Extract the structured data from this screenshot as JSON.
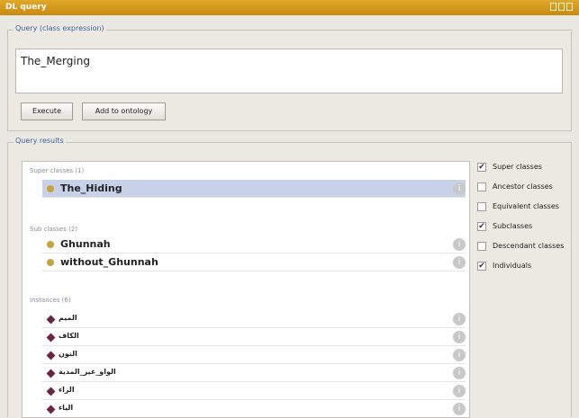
{
  "window": {
    "title": "DL query"
  },
  "query": {
    "title": "Query (class expression)",
    "expression": "The_Merging",
    "execute_label": "Execute",
    "add_label": "Add to ontology"
  },
  "results": {
    "title": "Query results",
    "super_title": "Super classes (1)",
    "super_items": [
      {
        "label": "The_Hiding"
      }
    ],
    "sub_title": "Sub classes (2)",
    "sub_items": [
      {
        "label": "Ghunnah"
      },
      {
        "label": "without_Ghunnah"
      }
    ],
    "inst_title": "Instances (6)",
    "instances": [
      {
        "label": "الميم"
      },
      {
        "label": "الكاف"
      },
      {
        "label": "النون"
      },
      {
        "label": "الواو_غير_المدية"
      },
      {
        "label": "الزاء"
      },
      {
        "label": "الياء"
      }
    ],
    "info_icon": "i"
  },
  "options": [
    {
      "label": "Super classes",
      "checked": true
    },
    {
      "label": "Ancestor classes",
      "checked": false
    },
    {
      "label": "Equivalent classes",
      "checked": false
    },
    {
      "label": "Subclasses",
      "checked": true
    },
    {
      "label": "Descendant classes",
      "checked": false
    },
    {
      "label": "Individuals",
      "checked": true
    }
  ],
  "colors": {
    "titlebar": "#d89a1a",
    "selected_row": "#c7d2e8",
    "class_dot": "#c7a040",
    "instance_diamond": "#6b2540"
  },
  "icons": {
    "class": "class-circle-icon",
    "instance": "instance-diamond-icon",
    "info": "info-icon",
    "check": "✔"
  }
}
